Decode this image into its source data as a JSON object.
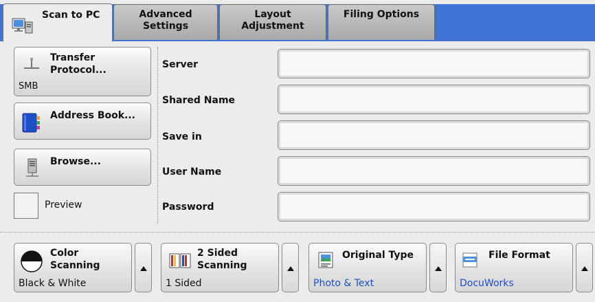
{
  "tabs": {
    "scan_to_pc": "Scan to PC",
    "advanced_line1": "Advanced",
    "advanced_line2": "Settings",
    "layout_line1": "Layout",
    "layout_line2": "Adjustment",
    "filing": "Filing Options"
  },
  "left_panel": {
    "transfer_line1": "Transfer",
    "transfer_line2": "Protocol...",
    "transfer_value": "SMB",
    "address_book": "Address Book...",
    "browse": "Browse...",
    "preview": "Preview"
  },
  "fields": {
    "server_label": "Server",
    "shared_name_label": "Shared Name",
    "save_in_label": "Save in",
    "user_name_label": "User Name",
    "password_label": "Password"
  },
  "bottom": {
    "color_line1": "Color",
    "color_line2": "Scanning",
    "color_value": "Black & White",
    "sided_line1": "2 Sided",
    "sided_line2": "Scanning",
    "sided_value": "1 Sided",
    "original_title": "Original Type",
    "original_value": "Photo & Text",
    "format_title": "File Format",
    "format_value": "DocuWorks"
  },
  "colors": {
    "tab_bar": "#3f73d6",
    "value_blue": "#1f4fc8"
  }
}
